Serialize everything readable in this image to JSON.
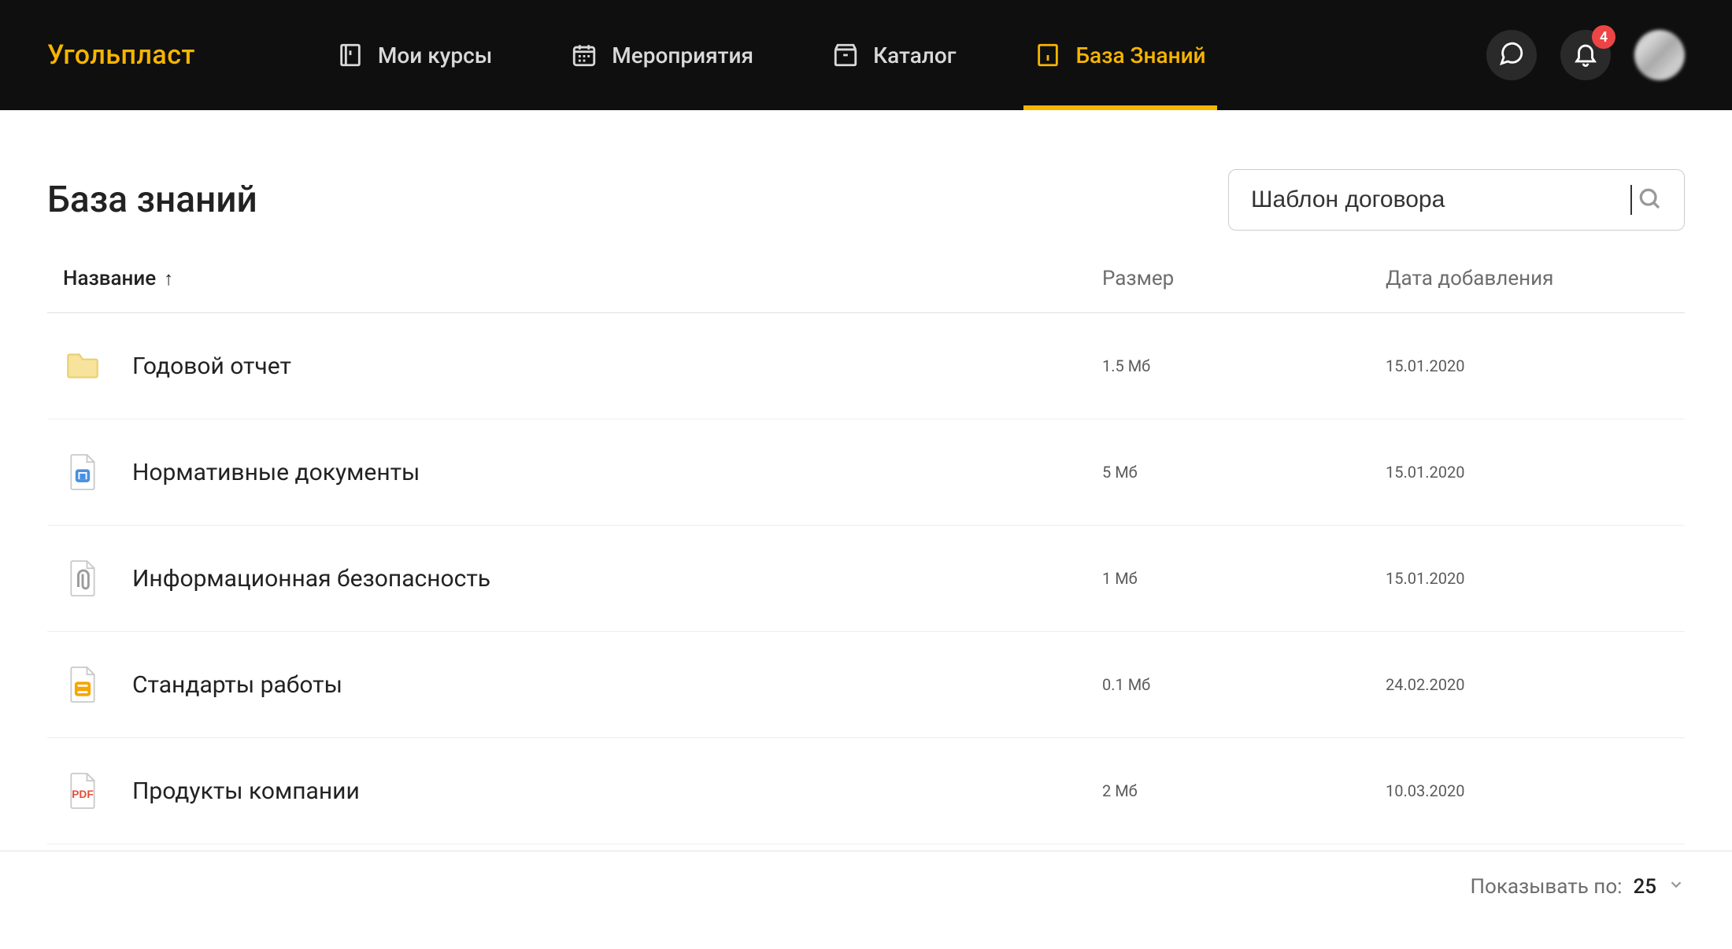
{
  "brand": {
    "name": "Угольпласт"
  },
  "nav": {
    "items": [
      {
        "label": "Мои курсы",
        "icon": "book"
      },
      {
        "label": "Мероприятия",
        "icon": "calendar"
      },
      {
        "label": "Каталог",
        "icon": "box"
      },
      {
        "label": "База Знаний",
        "icon": "info",
        "active": true
      }
    ]
  },
  "header": {
    "notification_count": "4"
  },
  "page": {
    "title": "База знаний"
  },
  "search": {
    "value": "Шаблон договора"
  },
  "table": {
    "columns": {
      "name": "Название",
      "size": "Размер",
      "date": "Дата добавления"
    },
    "sort_arrow": "↑",
    "rows": [
      {
        "name": "Годовой отчет",
        "size": "1.5 Мб",
        "date": "15.01.2020",
        "icon": "folder"
      },
      {
        "name": "Нормативные документы",
        "size": "5 Мб",
        "date": "15.01.2020",
        "icon": "doc-blue"
      },
      {
        "name": "Информационная безопасность",
        "size": "1 Мб",
        "date": "15.01.2020",
        "icon": "doc-clip"
      },
      {
        "name": "Стандарты работы",
        "size": "0.1 Мб",
        "date": "24.02.2020",
        "icon": "doc-orange"
      },
      {
        "name": "Продукты компании",
        "size": "2 Мб",
        "date": "10.03.2020",
        "icon": "pdf"
      }
    ]
  },
  "pager": {
    "label": "Показывать по:",
    "value": "25"
  }
}
